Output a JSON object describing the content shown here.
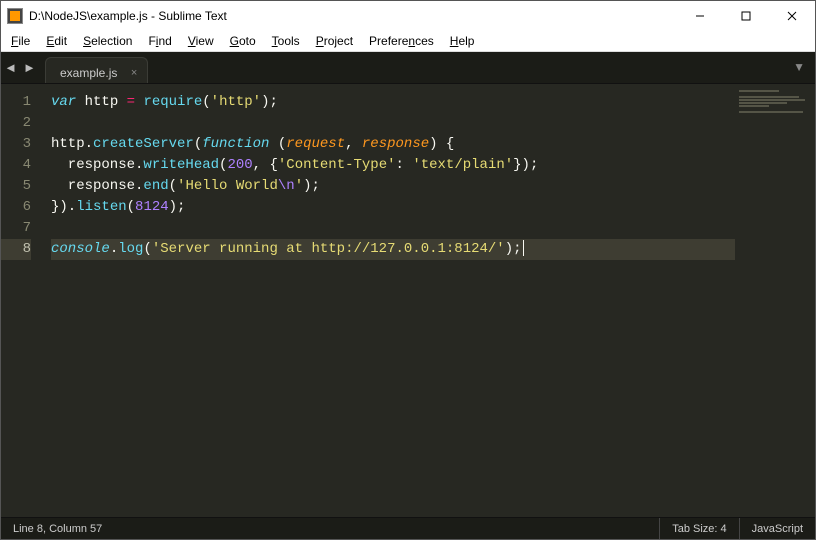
{
  "window": {
    "title": "D:\\NodeJS\\example.js - Sublime Text"
  },
  "menu": {
    "items": [
      {
        "label": "File",
        "ul": "F",
        "rest": "ile"
      },
      {
        "label": "Edit",
        "ul": "E",
        "rest": "dit"
      },
      {
        "label": "Selection",
        "ul": "S",
        "rest": "election"
      },
      {
        "label": "Find",
        "ul": "i",
        "pre": "F",
        "rest": "nd"
      },
      {
        "label": "View",
        "ul": "V",
        "rest": "iew"
      },
      {
        "label": "Goto",
        "ul": "G",
        "rest": "oto"
      },
      {
        "label": "Tools",
        "ul": "T",
        "rest": "ools"
      },
      {
        "label": "Project",
        "ul": "P",
        "rest": "roject"
      },
      {
        "label": "Preferences",
        "ul": "n",
        "pre": "Prefere",
        "rest": "ces"
      },
      {
        "label": "Help",
        "ul": "H",
        "rest": "elp"
      }
    ]
  },
  "tabs": {
    "active": {
      "label": "example.js"
    }
  },
  "code": {
    "lines": [
      [
        {
          "cls": "tok-decl",
          "t": "var"
        },
        {
          "cls": "tok-plain",
          "t": " http "
        },
        {
          "cls": "tok-kw",
          "t": "="
        },
        {
          "cls": "tok-plain",
          "t": " "
        },
        {
          "cls": "tok-fn",
          "t": "require"
        },
        {
          "cls": "tok-plain",
          "t": "("
        },
        {
          "cls": "tok-str",
          "t": "'http'"
        },
        {
          "cls": "tok-plain",
          "t": ");"
        }
      ],
      [],
      [
        {
          "cls": "tok-plain",
          "t": "http."
        },
        {
          "cls": "tok-fn",
          "t": "createServer"
        },
        {
          "cls": "tok-plain",
          "t": "("
        },
        {
          "cls": "tok-decl",
          "t": "function"
        },
        {
          "cls": "tok-plain",
          "t": " ("
        },
        {
          "cls": "tok-param",
          "t": "request"
        },
        {
          "cls": "tok-plain",
          "t": ", "
        },
        {
          "cls": "tok-param",
          "t": "response"
        },
        {
          "cls": "tok-plain",
          "t": ") {"
        }
      ],
      [
        {
          "cls": "tok-plain",
          "t": "  response."
        },
        {
          "cls": "tok-fn",
          "t": "writeHead"
        },
        {
          "cls": "tok-plain",
          "t": "("
        },
        {
          "cls": "tok-num",
          "t": "200"
        },
        {
          "cls": "tok-plain",
          "t": ", {"
        },
        {
          "cls": "tok-str",
          "t": "'Content-Type'"
        },
        {
          "cls": "tok-plain",
          "t": ": "
        },
        {
          "cls": "tok-str",
          "t": "'text/plain'"
        },
        {
          "cls": "tok-plain",
          "t": "});"
        }
      ],
      [
        {
          "cls": "tok-plain",
          "t": "  response."
        },
        {
          "cls": "tok-fn",
          "t": "end"
        },
        {
          "cls": "tok-plain",
          "t": "("
        },
        {
          "cls": "tok-str",
          "t": "'Hello World"
        },
        {
          "cls": "tok-esc",
          "t": "\\n"
        },
        {
          "cls": "tok-str",
          "t": "'"
        },
        {
          "cls": "tok-plain",
          "t": ");"
        }
      ],
      [
        {
          "cls": "tok-plain",
          "t": "})."
        },
        {
          "cls": "tok-fn",
          "t": "listen"
        },
        {
          "cls": "tok-plain",
          "t": "("
        },
        {
          "cls": "tok-num",
          "t": "8124"
        },
        {
          "cls": "tok-plain",
          "t": ");"
        }
      ],
      [],
      [
        {
          "cls": "tok-builtin",
          "t": "console"
        },
        {
          "cls": "tok-plain",
          "t": "."
        },
        {
          "cls": "tok-fn",
          "t": "log"
        },
        {
          "cls": "tok-plain",
          "t": "("
        },
        {
          "cls": "tok-str",
          "t": "'Server running at http://127.0.0.1:8124/'"
        },
        {
          "cls": "tok-plain",
          "t": ");"
        }
      ]
    ],
    "highlighted_line": 8
  },
  "status": {
    "position": "Line 8, Column 57",
    "tab_size": "Tab Size: 4",
    "language": "JavaScript"
  }
}
